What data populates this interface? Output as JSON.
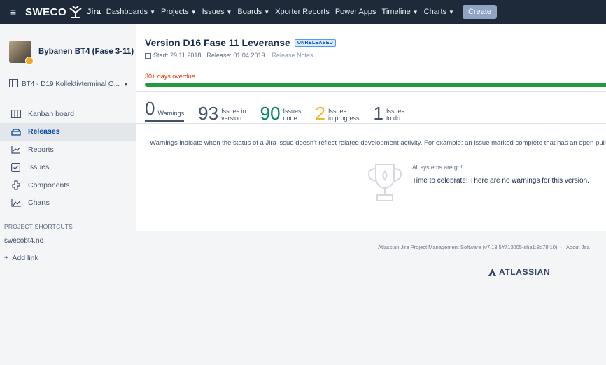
{
  "topnav": {
    "brand": "SWECO",
    "product": "Jira",
    "items": [
      {
        "label": "Dashboards",
        "caret": true
      },
      {
        "label": "Projects",
        "caret": true
      },
      {
        "label": "Issues",
        "caret": true
      },
      {
        "label": "Boards",
        "caret": true
      },
      {
        "label": "Xporter Reports",
        "caret": false
      },
      {
        "label": "Power Apps",
        "caret": false
      },
      {
        "label": "Timeline",
        "caret": true
      },
      {
        "label": "Charts",
        "caret": true
      }
    ],
    "create_label": "Create"
  },
  "sidebar": {
    "project_name": "Bybanen BT4 (Fase 3-11)",
    "board_selector": "BT4 - D19 Kollektivterminal O...",
    "items": [
      {
        "label": "Kanban board",
        "icon": "kanban-board-icon",
        "active": false
      },
      {
        "label": "Releases",
        "icon": "releases-icon",
        "active": true
      },
      {
        "label": "Reports",
        "icon": "reports-icon",
        "active": false
      },
      {
        "label": "Issues",
        "icon": "issues-icon",
        "active": false
      },
      {
        "label": "Components",
        "icon": "components-icon",
        "active": false
      },
      {
        "label": "Charts",
        "icon": "charts-icon",
        "active": false
      }
    ],
    "shortcuts_title": "PROJECT SHORTCUTS",
    "shortcut": "swecobt4.no",
    "add_link": "Add link"
  },
  "version": {
    "title": "Version D16 Fase 11 Leveranse",
    "status": "UNRELEASED",
    "start": "Start: 29.11.2018",
    "release": "Release: 01.04.2019",
    "release_notes": "Release Notes",
    "overdue": "30+ days overdue",
    "progress_done_fraction": 1.0
  },
  "stats": {
    "warnings": {
      "num": "0",
      "label": "Warnings"
    },
    "in_version": {
      "num": "93",
      "label1": "Issues in",
      "label2": "version"
    },
    "done": {
      "num": "90",
      "label1": "Issues",
      "label2": "done"
    },
    "in_progress": {
      "num": "2",
      "label1": "Issues",
      "label2": "in progress"
    },
    "to_do": {
      "num": "1",
      "label1": "Issues",
      "label2": "to do"
    }
  },
  "warnings_info": "Warnings indicate when the status of a Jira issue doesn't reflect related development activity. For example: an issue marked complete that has an open pull re",
  "empty_state": {
    "small": "All systems are go!",
    "large": "Time to celebrate! There are no warnings for this version."
  },
  "footer": {
    "software": "Atlassian Jira Project Management Software (v7.13.5#713005-sha1:8d78f10)",
    "about": "About Jira",
    "logo": "ATLASSIAN"
  },
  "colors": {
    "nav_bg": "#1e2a3a",
    "progress_done": "#1f9c3e",
    "overdue": "#de350b",
    "done_num": "#00875a",
    "in_progress_num": "#f6b625"
  }
}
